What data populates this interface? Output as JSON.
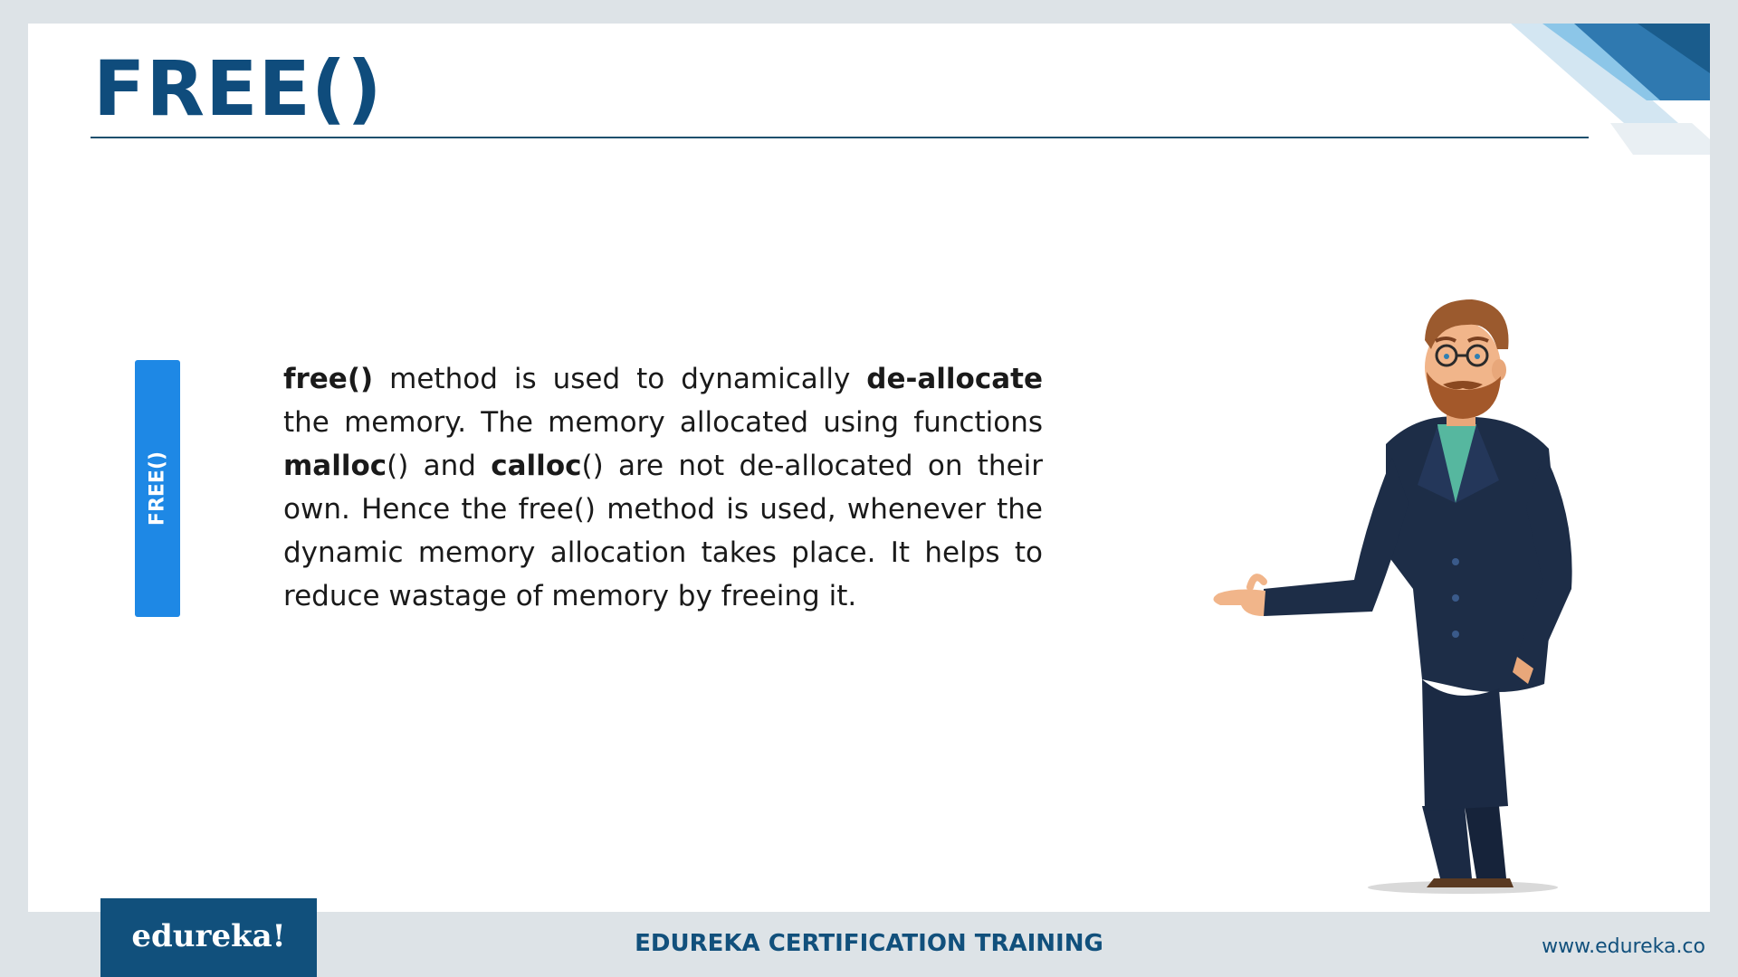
{
  "slide": {
    "title": "FREE()",
    "side_tab_label": "FREE()",
    "body_runs": [
      {
        "text": "free()",
        "bold": true
      },
      {
        "text": " method is used to dynamically ",
        "bold": false
      },
      {
        "text": "de-allocate",
        "bold": true
      },
      {
        "text": " the memory. The memory allocated using functions ",
        "bold": false
      },
      {
        "text": "malloc",
        "bold": true
      },
      {
        "text": "() and ",
        "bold": false
      },
      {
        "text": "calloc",
        "bold": true
      },
      {
        "text": "() are not de-allocated on their own. Hence the free() method is used, whenever the dynamic memory allocation takes place. It helps to reduce wastage of memory by freeing it.",
        "bold": false
      }
    ]
  },
  "footer": {
    "logo_text": "edureka!",
    "title": "EDUREKA CERTIFICATION TRAINING",
    "url": "www.edureka.co"
  },
  "colors": {
    "title_blue": "#0f4c7c",
    "tab_blue": "#1e88e5",
    "footer_blue": "#11507c",
    "frame_gray": "#dde3e7"
  },
  "icons": {
    "presenter": "presenter-man-illustration",
    "corner": "corner-stripes-decoration"
  }
}
